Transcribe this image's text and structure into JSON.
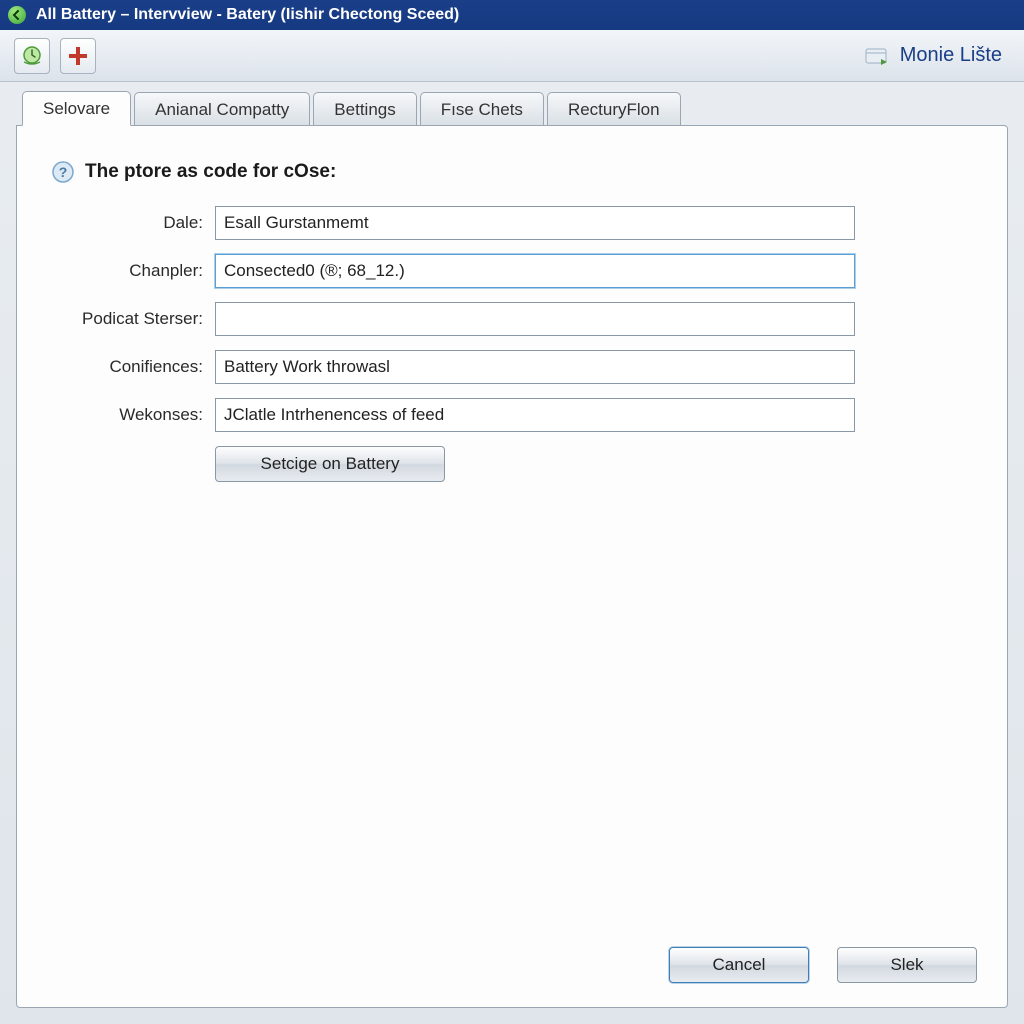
{
  "window": {
    "title": "All Battery – Intervview - Batery (Iishir Chectong Sceed)"
  },
  "toolbar": {
    "refresh_icon": "refresh-icon",
    "add_icon": "plus-icon",
    "right_link_label": "Monie Lište"
  },
  "tabs": [
    {
      "label": "Selovare",
      "active": true
    },
    {
      "label": "Anianal Compatty",
      "active": false
    },
    {
      "label": "Bettings",
      "active": false
    },
    {
      "label": "Fıse Chets",
      "active": false
    },
    {
      "label": "RecturyFlon",
      "active": false
    }
  ],
  "panel": {
    "heading": "The ptore as code for cOse:",
    "fields": {
      "dale": {
        "label": "Dale:",
        "value": "Esall Gurstanmemt"
      },
      "chanpler": {
        "label": "Chanpler:",
        "value": "Consected0 (®; 68_12.)"
      },
      "podicat": {
        "label": "Podicat Sterser:",
        "value": ""
      },
      "conifiences": {
        "label": "Conifiences:",
        "value": "Battery Work throwasl"
      },
      "wekonses": {
        "label": "Wekonses:",
        "value": "JClatle Intrhenencess of feed"
      }
    },
    "action_button": "Setcige on Battery"
  },
  "footer": {
    "cancel": "Cancel",
    "ok": "Slek"
  },
  "colors": {
    "titlebar_bg": "#163a82",
    "accent": "#3e7fb8"
  }
}
